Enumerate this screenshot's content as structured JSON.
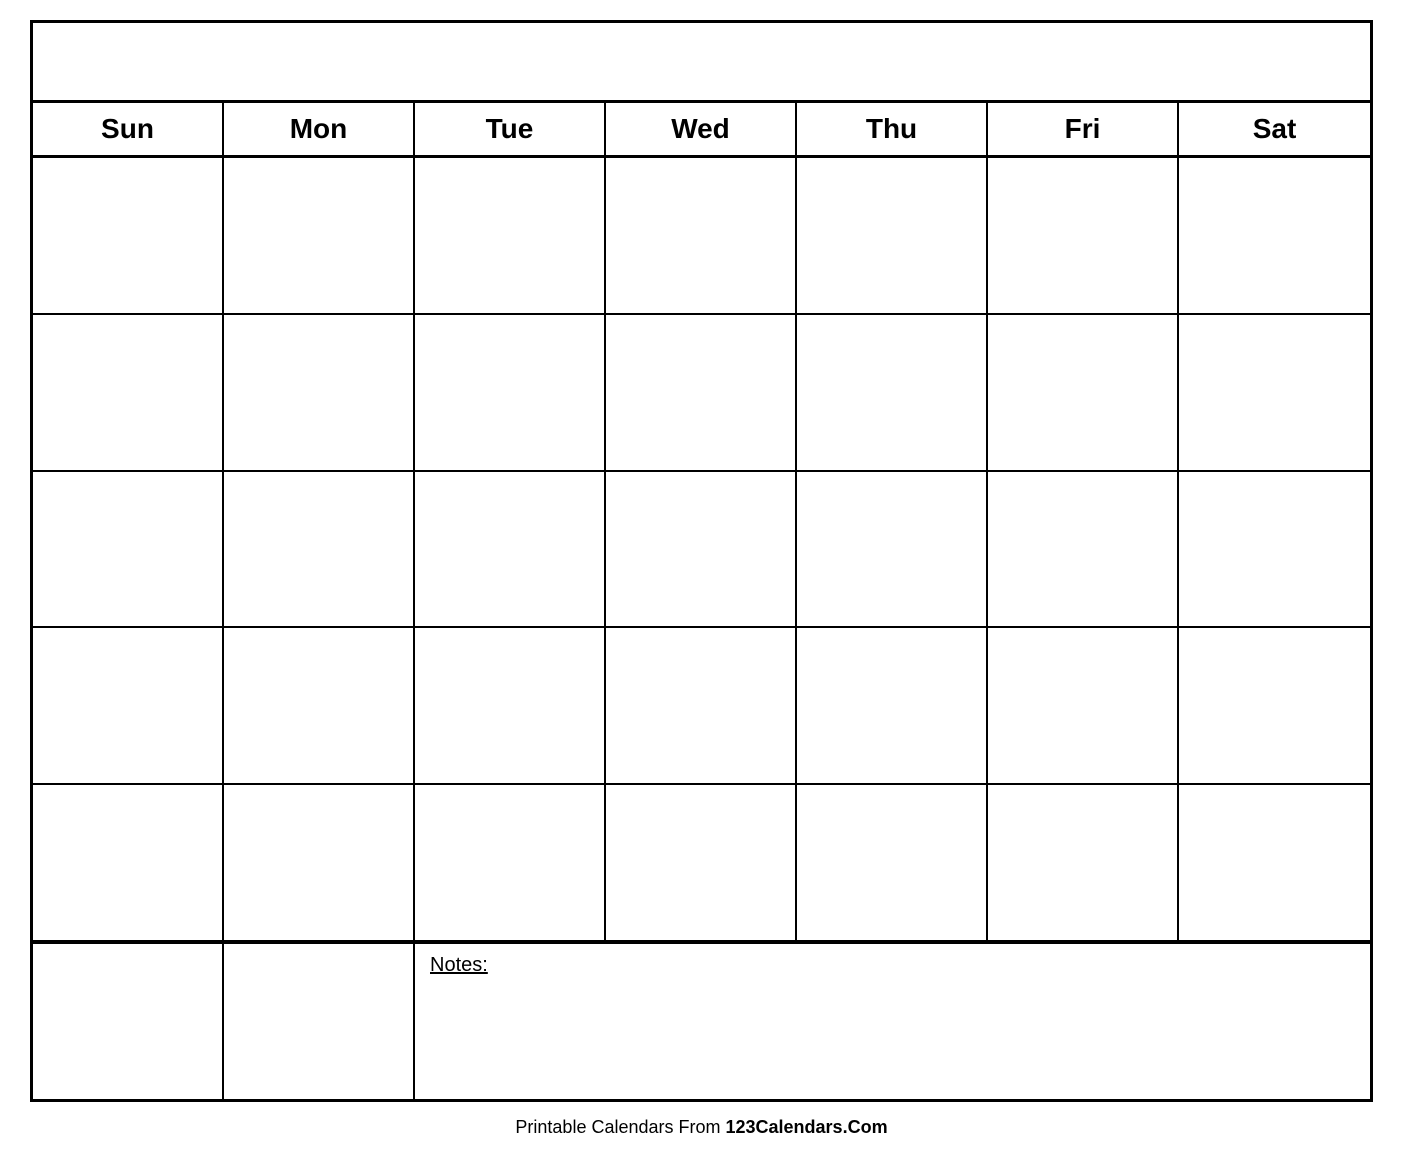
{
  "calendar": {
    "title": "",
    "days": [
      "Sun",
      "Mon",
      "Tue",
      "Wed",
      "Thu",
      "Fri",
      "Sat"
    ],
    "weeks": [
      [
        "",
        "",
        "",
        "",
        "",
        "",
        ""
      ],
      [
        "",
        "",
        "",
        "",
        "",
        "",
        ""
      ],
      [
        "",
        "",
        "",
        "",
        "",
        "",
        ""
      ],
      [
        "",
        "",
        "",
        "",
        "",
        "",
        ""
      ],
      [
        "",
        "",
        "",
        "",
        "",
        "",
        ""
      ]
    ],
    "notes_label": "Notes:"
  },
  "footer": {
    "text_normal": "Printable Calendars From ",
    "text_bold": "123Calendars.Com"
  }
}
